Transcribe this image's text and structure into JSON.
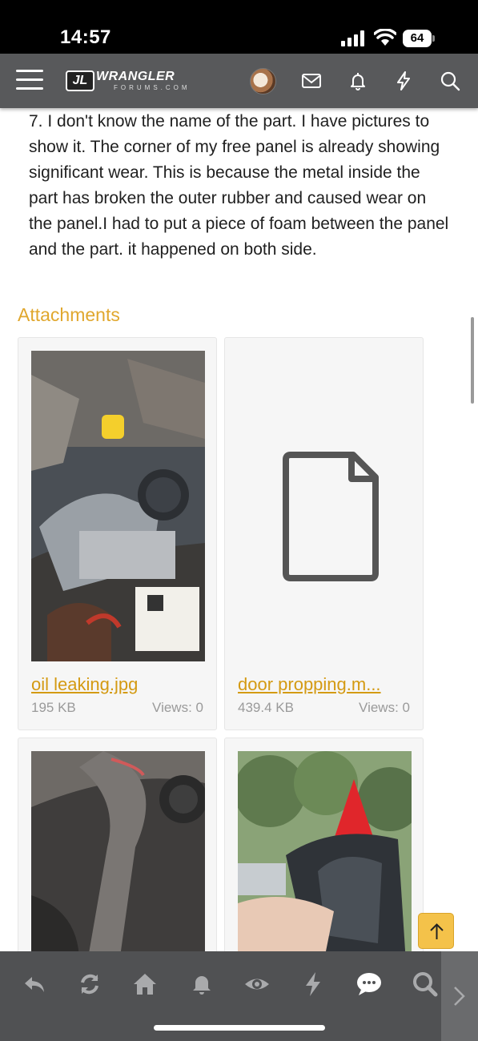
{
  "status_bar": {
    "time": "14:57",
    "battery": "64"
  },
  "header": {
    "logo_text": "WRANGLER",
    "logo_badge": "JL",
    "logo_subtext": "FORUMS.COM"
  },
  "post": {
    "text": "7. I don't know the name of the part. I have pictures to show it. The corner of my free panel is already showing significant wear. This is because the metal inside the part has broken the outer rubber and caused wear on the panel.I had to put a piece of foam between the panel and the part. it happened on both side."
  },
  "attachments": {
    "title": "Attachments",
    "items": [
      {
        "name": "oil leaking.jpg",
        "size": "195 KB",
        "views": "Views: 0",
        "thumb": "photo-engine"
      },
      {
        "name": "door propping.m...",
        "size": "439.4 KB",
        "views": "Views: 0",
        "thumb": "file-icon"
      },
      {
        "thumb": "photo-interior"
      },
      {
        "thumb": "photo-door-seal"
      }
    ]
  },
  "bottom_nav": [
    "reply-icon",
    "refresh-icon",
    "home-icon",
    "bell-icon",
    "eye-icon",
    "bolt-icon",
    "chat-icon",
    "search-icon"
  ],
  "colors": {
    "header_bg": "#58595b",
    "accent": "#e0a72e",
    "link": "#d49a12",
    "bottom_bar": "#505153"
  }
}
